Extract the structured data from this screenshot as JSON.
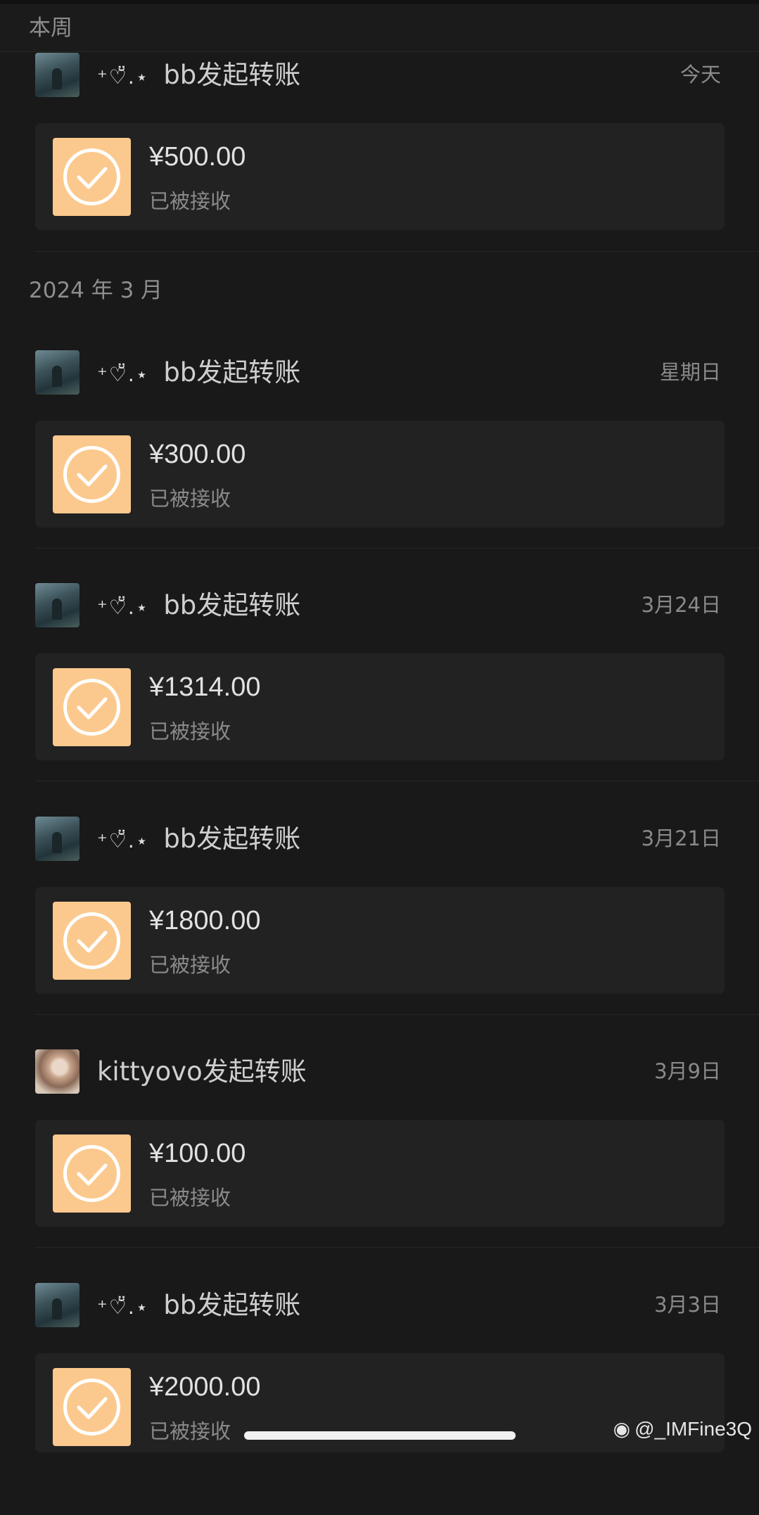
{
  "sections": {
    "this_week": "本周",
    "march": "2024 年 3 月"
  },
  "records": [
    {
      "nick": "⁺♡̆̈.⋆",
      "name": "bb发起转账",
      "date": "今天",
      "amount": "¥500.00",
      "status": "已被接收",
      "avatar": "forest-avatar"
    },
    {
      "nick": "⁺♡̆̈.⋆",
      "name": "bb发起转账",
      "date": "星期日",
      "amount": "¥300.00",
      "status": "已被接收",
      "avatar": "forest-avatar"
    },
    {
      "nick": "⁺♡̆̈.⋆",
      "name": "bb发起转账",
      "date": "3月24日",
      "amount": "¥1314.00",
      "status": "已被接收",
      "avatar": "forest-avatar"
    },
    {
      "nick": "⁺♡̆̈.⋆",
      "name": "bb发起转账",
      "date": "3月21日",
      "amount": "¥1800.00",
      "status": "已被接收",
      "avatar": "forest-avatar"
    },
    {
      "nick": "",
      "name": "kittyovo发起转账",
      "date": "3月9日",
      "amount": "¥100.00",
      "status": "已被接收",
      "avatar": "selfie-avatar"
    },
    {
      "nick": "⁺♡̆̈.⋆",
      "name": "bb发起转账",
      "date": "3月3日",
      "amount": "¥2000.00",
      "status": "已被接收",
      "avatar": "forest-avatar"
    }
  ],
  "watermark": {
    "icon": "weibo-icon",
    "text": "@_IMFine3Q"
  },
  "colors": {
    "background": "#191919",
    "card": "#222222",
    "check_tile": "#fbc98e"
  }
}
